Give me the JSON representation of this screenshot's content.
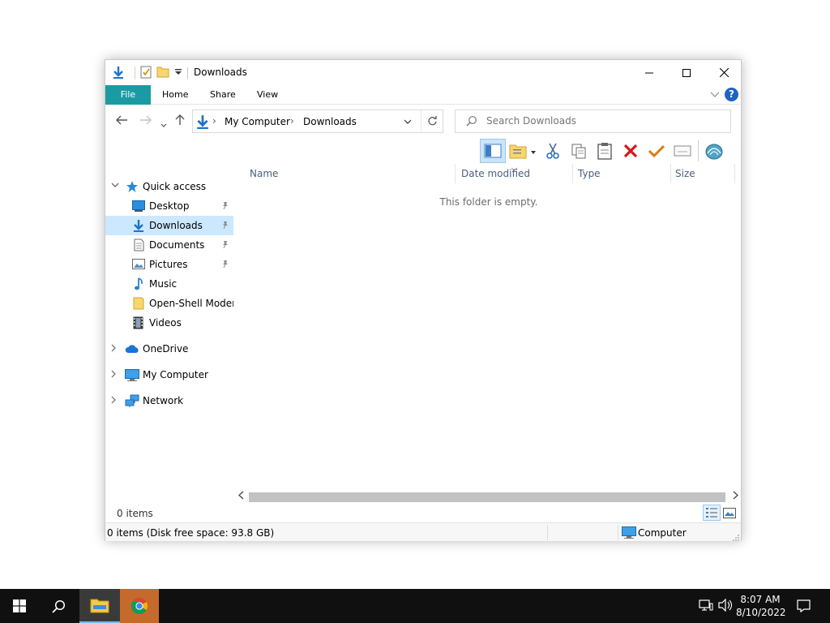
{
  "window": {
    "title": "Downloads",
    "controls": {
      "minimize": "minimize",
      "maximize": "maximize",
      "close": "close"
    }
  },
  "ribbon": {
    "tabs": [
      {
        "label": "File"
      },
      {
        "label": "Home"
      },
      {
        "label": "Share"
      },
      {
        "label": "View"
      }
    ]
  },
  "address": {
    "crumbs": [
      "My Computer",
      "Downloads"
    ]
  },
  "search": {
    "placeholder": "Search Downloads"
  },
  "navpane": {
    "quick_access": "Quick access",
    "items": [
      {
        "label": "Desktop",
        "pinned": true
      },
      {
        "label": "Downloads",
        "pinned": true,
        "selected": true
      },
      {
        "label": "Documents",
        "pinned": true
      },
      {
        "label": "Pictures",
        "pinned": true
      },
      {
        "label": "Music",
        "pinned": false
      },
      {
        "label": "Open-Shell Modern",
        "pinned": false
      },
      {
        "label": "Videos",
        "pinned": false
      }
    ],
    "roots": [
      {
        "label": "OneDrive"
      },
      {
        "label": "My Computer"
      },
      {
        "label": "Network"
      }
    ]
  },
  "content": {
    "columns": [
      "Name",
      "Date modified",
      "Type",
      "Size"
    ],
    "empty_message": "This folder is empty."
  },
  "status": {
    "items_count": "0 items",
    "disk_info": "0 items (Disk free space: 93.8 GB)",
    "location": "Computer"
  },
  "taskbar": {
    "time": "8:07 AM",
    "date": "8/10/2022"
  },
  "colors": {
    "file_tab": "#1a9ba3",
    "selection": "#cce8ff",
    "taskbar": "#101010",
    "chrome_task": "#c66a2b"
  }
}
